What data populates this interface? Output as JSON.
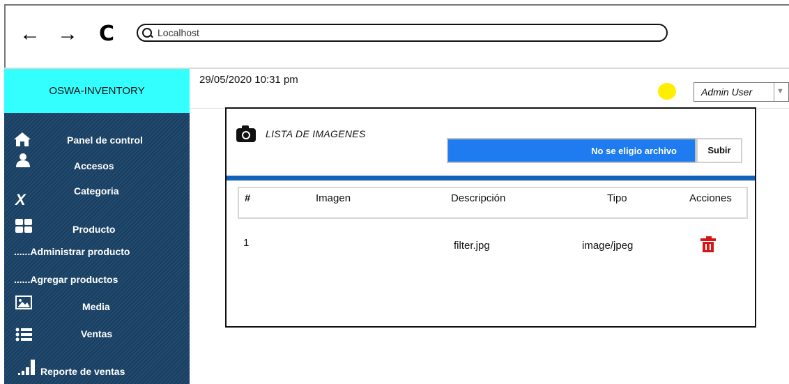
{
  "browser": {
    "back_icon": "←",
    "forward_icon": "→",
    "reload_icon": "C",
    "url_placeholder": "Localhost"
  },
  "app": {
    "brand": "OSWA-INVENTORY",
    "brand_color": "#33ffff",
    "sidebar_color": "#173f63"
  },
  "sidebar": {
    "items": [
      {
        "label": "Panel de control",
        "icon": "home-icon"
      },
      {
        "label": "Accesos",
        "icon": "user-icon"
      },
      {
        "label": "Categoria",
        "icon": "xing-icon"
      },
      {
        "label": "Producto",
        "icon": "grid-icon"
      },
      {
        "label": "......Administrar producto"
      },
      {
        "label": "......Agregar productos"
      },
      {
        "label": "Media",
        "icon": "image-icon"
      },
      {
        "label": "Ventas",
        "icon": "list-icon"
      },
      {
        "label": "Reporte de ventas",
        "icon": "signal-bars-icon"
      }
    ]
  },
  "header": {
    "datetime": "29/05/2020 10:31 pm",
    "status_color": "#ffee00",
    "user": "Admin User"
  },
  "panel": {
    "title": "LISTA DE IMAGENES",
    "file_input_label": "No se eligio archivo",
    "upload_button": "Subir",
    "columns": [
      "#",
      "Imagen",
      "Descripción",
      "Tipo",
      "Acciones"
    ],
    "rows": [
      {
        "num": "1",
        "imagen": "",
        "descripcion": "filter.jpg",
        "tipo": "image/jpeg"
      }
    ]
  }
}
